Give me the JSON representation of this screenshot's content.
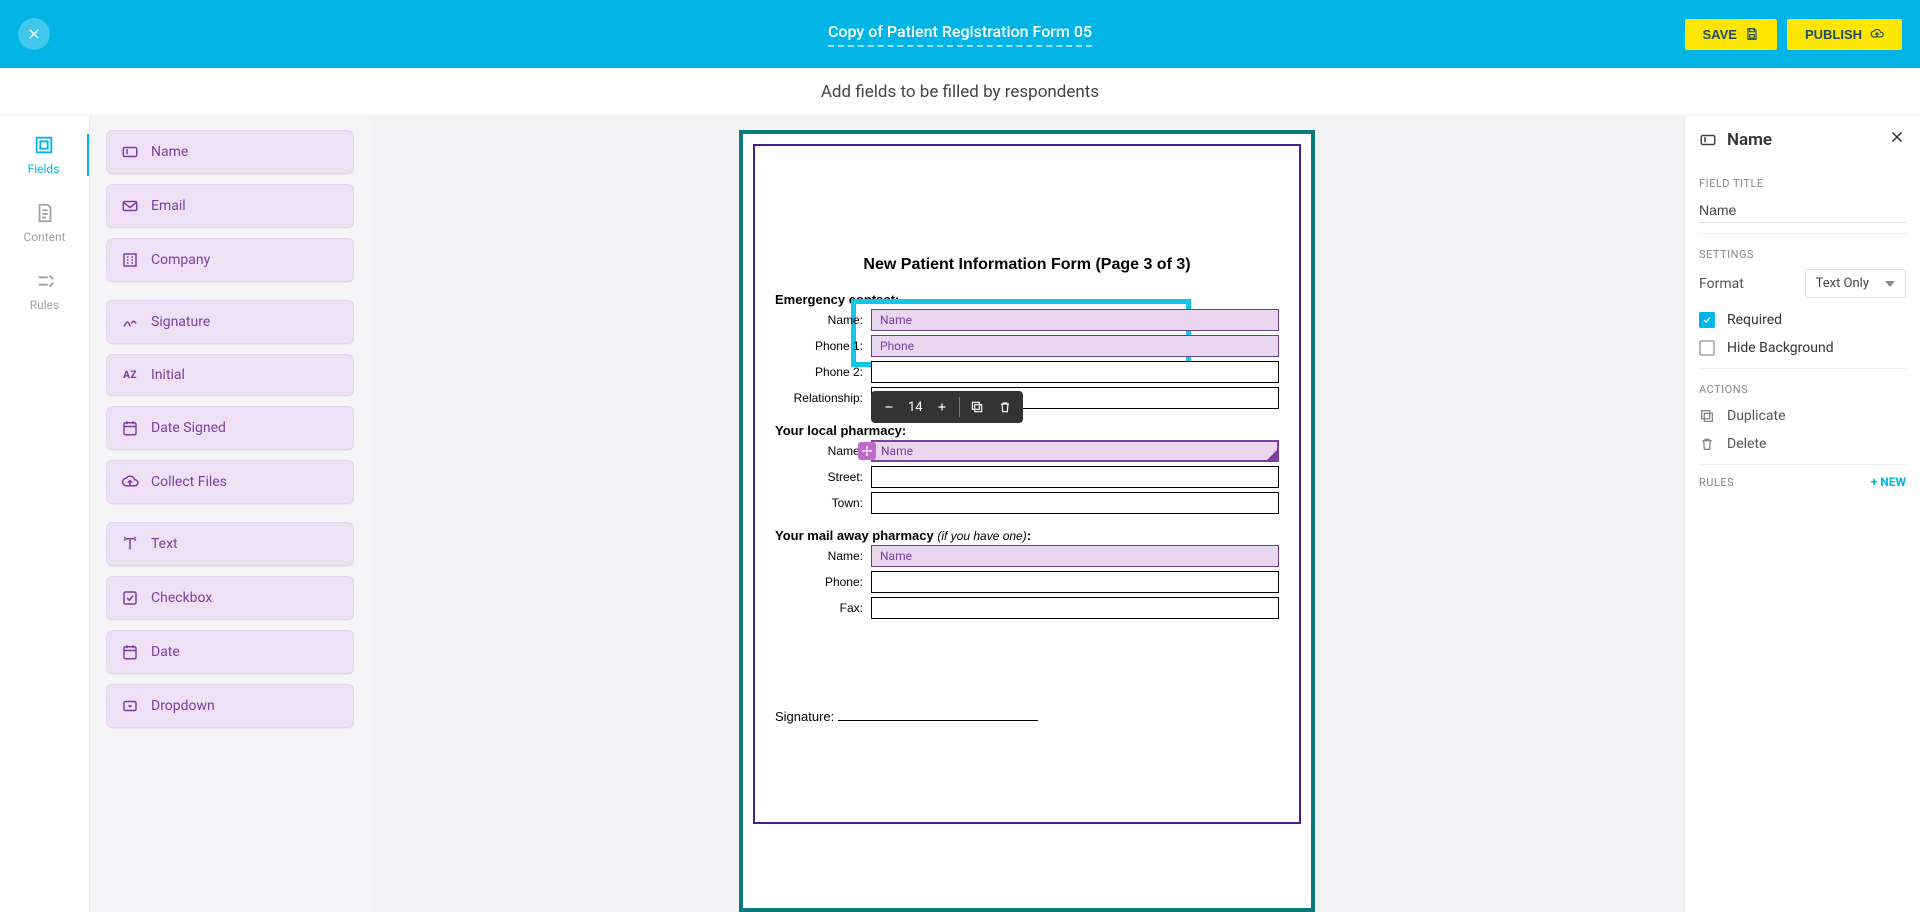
{
  "header": {
    "title": "Copy of Patient Registration Form 05",
    "save": "SAVE",
    "publish": "PUBLISH"
  },
  "subheader": "Add fields to be filled by respondents",
  "nav": {
    "fields": "Fields",
    "content": "Content",
    "rules": "Rules"
  },
  "palette_groups": [
    [
      "Name",
      "Email",
      "Company"
    ],
    [
      "Signature",
      "Initial",
      "Date Signed",
      "Collect Files"
    ],
    [
      "Text",
      "Checkbox",
      "Date",
      "Dropdown"
    ]
  ],
  "doc": {
    "title": "New Patient Information Form (Page 3 of 3)",
    "sections": {
      "emergency": {
        "head": "Emergency contact:",
        "rows": [
          {
            "label": "Name:",
            "type": "placed",
            "placeholder": "Name"
          },
          {
            "label": "Phone 1:",
            "type": "placed",
            "placeholder": "Phone"
          },
          {
            "label": "Phone 2:",
            "type": "blank"
          },
          {
            "label": "Relationship:",
            "type": "blank"
          }
        ]
      },
      "pharmacy": {
        "head": "Your local pharmacy:",
        "rows": [
          {
            "label": "Name:",
            "type": "selected",
            "placeholder": "Name"
          },
          {
            "label": "Street:",
            "type": "blank"
          },
          {
            "label": "Town:",
            "type": "blank"
          }
        ]
      },
      "mailaway": {
        "head_a": "Your mail away pharmacy ",
        "head_b": "(if you have one)",
        "head_c": ":",
        "rows": [
          {
            "label": "Name:",
            "type": "placed",
            "placeholder": "Name"
          },
          {
            "label": "Phone:",
            "type": "blank"
          },
          {
            "label": "Fax:",
            "type": "blank"
          }
        ]
      }
    },
    "signature_label": "Signature:",
    "toolbar": {
      "size": "14"
    }
  },
  "props": {
    "panel_title": "Name",
    "field_title_heading": "FIELD TITLE",
    "field_title_value": "Name",
    "settings_heading": "SETTINGS",
    "format_label": "Format",
    "format_value": "Text Only",
    "required_label": "Required",
    "required_checked": true,
    "hide_bg_label": "Hide Background",
    "actions_heading": "ACTIONS",
    "duplicate": "Duplicate",
    "delete": "Delete",
    "rules_heading": "RULES",
    "new_rule": "+ NEW"
  }
}
